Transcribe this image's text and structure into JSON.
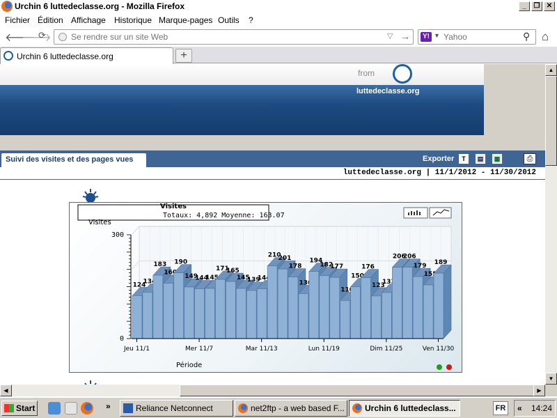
{
  "window": {
    "title": "Urchin 6 luttedeclasse.org - Mozilla Firefox"
  },
  "menu": [
    "Fichier",
    "Édition",
    "Affichage",
    "Historique",
    "Marque-pages",
    "Outils",
    "?"
  ],
  "urlbar": {
    "placeholder": "Se rendre sur un site Web"
  },
  "searchbar": {
    "placeholder": "Yahoo",
    "engine_badge": "Y!"
  },
  "tab": {
    "label": "Urchin 6 luttedeclasse.org"
  },
  "header": {
    "from": "from",
    "site": "luttedeclasse.org"
  },
  "report": {
    "tab_label": "Suivi des visites et des pages vues",
    "export_label": "Exporter",
    "export_icons": [
      "T",
      "csv",
      "xls"
    ],
    "date_line": "luttedeclasse.org  |  11/1/2012 - 11/30/2012"
  },
  "chart_data": {
    "type": "bar",
    "title": "Visites",
    "totals_text": "Totaux: 4,892   Moyenne: 163.07",
    "ylabel": "Visites",
    "xlabel": "Période",
    "ylim": [
      0,
      300
    ],
    "yticks": [
      "0",
      "300"
    ],
    "xtick_labels": [
      "Jeu 11/1",
      "Mer 11/7",
      "Mar 11/13",
      "Lun 11/19",
      "Dim 11/25",
      "Ven 11/30"
    ],
    "xtick_index": [
      0,
      6,
      12,
      18,
      24,
      29
    ],
    "categories": [
      "11/1",
      "11/2",
      "11/3",
      "11/4",
      "11/5",
      "11/6",
      "11/7",
      "11/8",
      "11/9",
      "11/10",
      "11/11",
      "11/12",
      "11/13",
      "11/14",
      "11/15",
      "11/16",
      "11/17",
      "11/18",
      "11/19",
      "11/20",
      "11/21",
      "11/22",
      "11/23",
      "11/24",
      "11/25",
      "11/26",
      "11/27",
      "11/28",
      "11/29",
      "11/30"
    ],
    "values": [
      124,
      134,
      183,
      160,
      190,
      149,
      144,
      145,
      171,
      165,
      145,
      139,
      144,
      210,
      201,
      178,
      130,
      194,
      182,
      177,
      110,
      150,
      176,
      123,
      133,
      206,
      206,
      179,
      155,
      189
    ],
    "bar_color": "#8fb1d6",
    "grid": true
  },
  "taskbar": {
    "start": "Start",
    "tasks": [
      "Reliance Netconnect",
      "net2ftp - a web based F...",
      "Urchin 6 luttedeclass..."
    ],
    "lang": "FR",
    "clock": "14:24",
    "tray_arrows": "«",
    "overflow": "»"
  }
}
